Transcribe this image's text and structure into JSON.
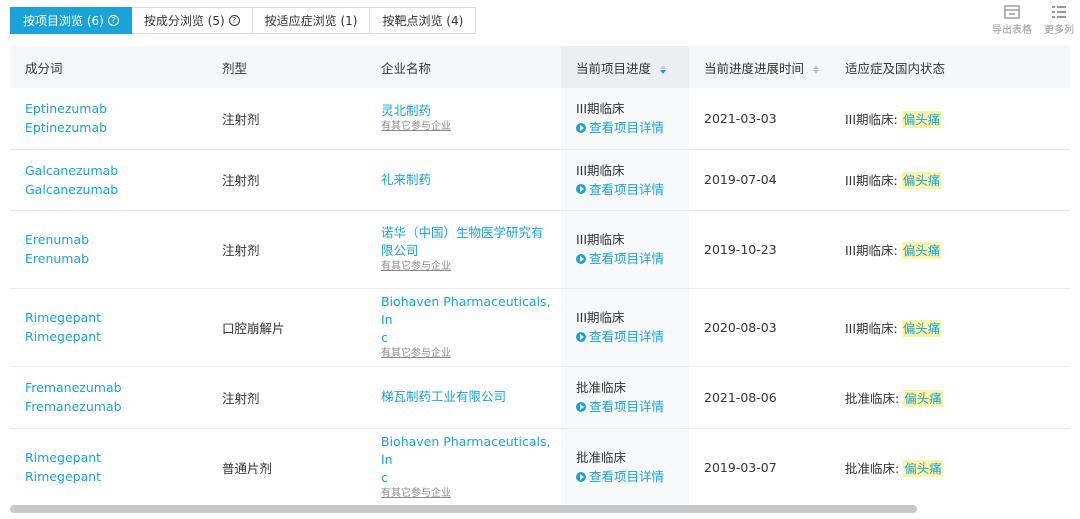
{
  "tabs": [
    {
      "label": "按项目浏览 (6)",
      "active": true,
      "help": true
    },
    {
      "label": "按成分浏览 (5)",
      "active": false,
      "help": true
    },
    {
      "label": "按适应症浏览 (1)",
      "active": false,
      "help": false
    },
    {
      "label": "按靶点浏览 (4)",
      "active": false,
      "help": false
    }
  ],
  "help_icon": "?",
  "tools": {
    "export_label": "导出表格",
    "more_label": "更多列"
  },
  "table": {
    "headers": [
      "成分词",
      "剂型",
      "企业名称",
      "当前项目进度",
      "当前进度进展时间",
      "适应症及国内状态"
    ],
    "detail_label": "查看项目详情",
    "other_label": "有其它参与企业",
    "rows": [
      {
        "ingredient_1": "Eptinezumab",
        "ingredient_2": "Eptinezumab",
        "form": "注射剂",
        "company_1": "灵北制药",
        "company_2": "",
        "stage": "III期临床",
        "date": "2021-03-03",
        "status": "III期临床:",
        "indication": "偏头痛"
      },
      {
        "ingredient_1": "Galcanezumab",
        "ingredient_2": "Galcanezumab",
        "form": "注射剂",
        "company_1": "礼来制药",
        "company_2": "",
        "stage": "III期临床",
        "date": "2019-07-04",
        "status": "III期临床:",
        "indication": "偏头痛"
      },
      {
        "ingredient_1": "Erenumab",
        "ingredient_2": "Erenumab",
        "form": "注射剂",
        "company_1": "诺华（中国）生物医学研究有",
        "company_2": "限公司",
        "stage": "III期临床",
        "date": "2019-10-23",
        "status": "III期临床:",
        "indication": "偏头痛"
      },
      {
        "ingredient_1": "Rimegepant",
        "ingredient_2": "Rimegepant",
        "form": "口腔崩解片",
        "company_1": "Biohaven Pharmaceuticals, In",
        "company_2": "c",
        "stage": "III期临床",
        "date": "2020-08-03",
        "status": "III期临床:",
        "indication": "偏头痛"
      },
      {
        "ingredient_1": "Fremanezumab",
        "ingredient_2": "Fremanezumab",
        "form": "注射剂",
        "company_1": "梯瓦制药工业有限公司",
        "company_2": "",
        "stage": "批准临床",
        "date": "2021-08-06",
        "status": "批准临床:",
        "indication": "偏头痛"
      },
      {
        "ingredient_1": "Rimegepant",
        "ingredient_2": "Rimegepant",
        "form": "普通片剂",
        "company_1": "Biohaven Pharmaceuticals, In",
        "company_2": "c",
        "stage": "批准临床",
        "date": "2019-03-07",
        "status": "批准临床:",
        "indication": "偏头痛"
      }
    ]
  },
  "colors": {
    "accent": "#1aa3d9",
    "highlight": "#fff3a6",
    "header_bg": "#f5f6f8"
  }
}
